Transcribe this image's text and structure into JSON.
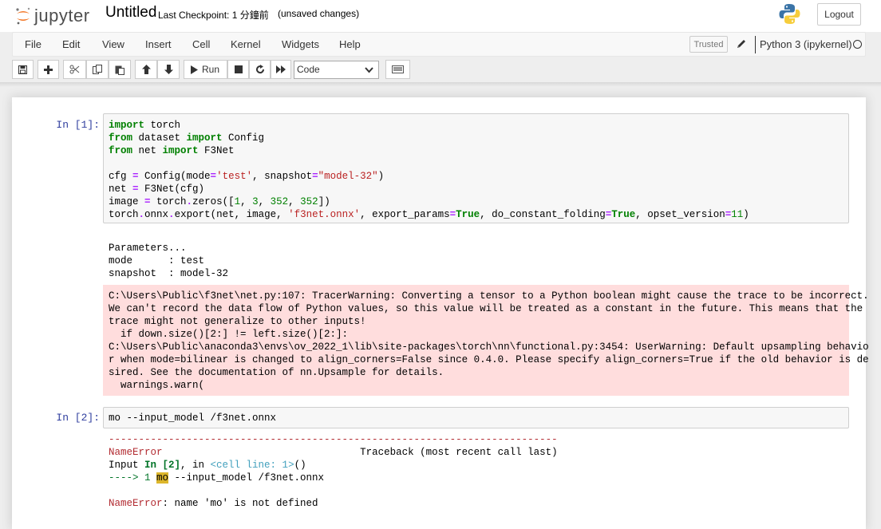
{
  "header": {
    "logo_text": "jupyter",
    "notebook_name": "Untitled",
    "checkpoint": "Last Checkpoint: 1 分鐘前",
    "autosave_status": "(unsaved changes)",
    "logout_label": "Logout"
  },
  "menubar": {
    "items": [
      "File",
      "Edit",
      "View",
      "Insert",
      "Cell",
      "Kernel",
      "Widgets",
      "Help"
    ],
    "trusted_label": "Trusted",
    "kernel_name": "Python 3 (ipykernel)"
  },
  "toolbar": {
    "run_label": "Run",
    "cell_type": "Code"
  },
  "cells": [
    {
      "prompt": "In [1]:",
      "code_lines": [
        "import torch",
        "from dataset import Config",
        "from net import F3Net",
        "",
        "cfg = Config(mode='test', snapshot=\"model-32\")",
        "net = F3Net(cfg)",
        "image = torch.zeros([1, 3, 352, 352])",
        "torch.onnx.export(net, image, 'f3net.onnx', export_params=True, do_constant_folding=True, opset_version=11)"
      ],
      "stdout_lines": [
        "Parameters...",
        "mode      : test",
        "snapshot  : model-32"
      ],
      "stderr_lines": [
        "C:\\Users\\Public\\f3net\\net.py:107: TracerWarning: Converting a tensor to a Python boolean might cause the trace to be incorrect.",
        "We can't record the data flow of Python values, so this value will be treated as a constant in the future. This means that the",
        "trace might not generalize to other inputs!",
        "  if down.size()[2:] != left.size()[2:]:",
        "C:\\Users\\Public\\anaconda3\\envs\\ov_2022_1\\lib\\site-packages\\torch\\nn\\functional.py:3454: UserWarning: Default upsampling behavio",
        "r when mode=bilinear is changed to align_corners=False since 0.4.0. Please specify align_corners=True if the old behavior is de",
        "sired. See the documentation of nn.Upsample for details.",
        "  warnings.warn("
      ]
    },
    {
      "prompt": "In [2]:",
      "code_text": "mo --input_model /f3net.onnx",
      "traceback": {
        "rule": "---------------------------------------------------------------------------",
        "error_name": "NameError",
        "traceback_label": "Traceback (most recent call last)",
        "input_prefix": "Input ",
        "input_ref": "In [2]",
        "input_mid": ", in ",
        "cell_line": "<cell line: 1>",
        "call_suffix": "()",
        "arrow": "----> 1 ",
        "offending": "mo",
        "rest": " --input_model /f3net.onnx",
        "final_name": "NameError",
        "final_msg": ": name 'mo' is not defined"
      }
    }
  ]
}
